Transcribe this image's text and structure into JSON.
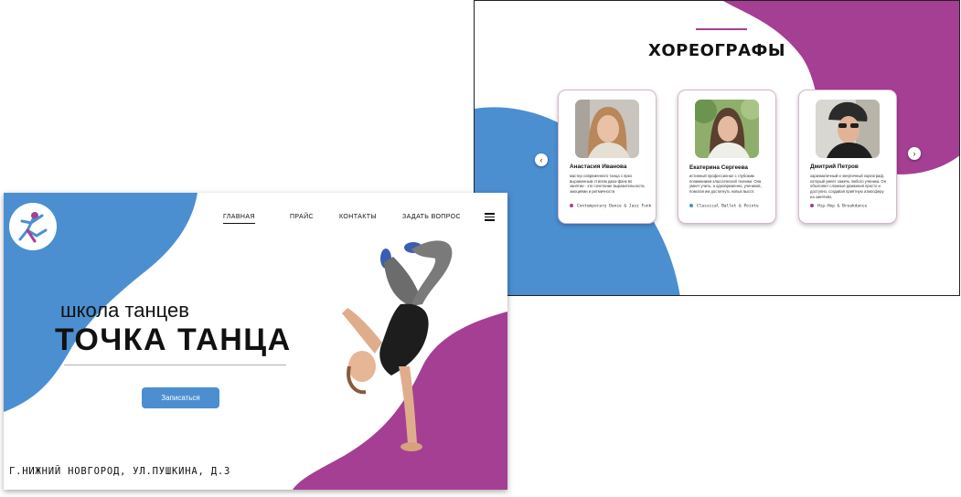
{
  "choreographers": {
    "title": "ХОРЕОГРАФЫ",
    "prev_arrow": "‹",
    "next_arrow": "›",
    "cards": [
      {
        "name": "Анастасия Иванова",
        "description": "мастер современного танца с ярко выраженным стилем джаз-фанк во занятии - это сочетание выразительности, эмоциями и ритмичности",
        "tag": "Contemporary Dance & Jazz Funk",
        "dot_color": "#a53f93"
      },
      {
        "name": "Екатерина Сергеева",
        "description": "истинный профессионал с глубоким пониманием классической техники. Она умеет учить, а одновременно, учеников, помогая им достигнуть новых высот.",
        "tag": "Classical Ballet & Pointe",
        "dot_color": "#4b8fd1"
      },
      {
        "name": "Дмитрий Петров",
        "description": "харизматичный и энергичный хореограф, который умеет зажечь любого ученика. Он объясняет сложные движения просто и доступно, создавая приятную атмосферу на занятиях.",
        "tag": "Hip-Hop & Breakdance",
        "dot_color": "#a53f93"
      }
    ]
  },
  "home": {
    "nav": {
      "home": "ГЛАВНАЯ",
      "price": "ПРАЙС",
      "contacts": "КОНТАКТЫ",
      "ask": "ЗАДАТЬ ВОПРОС"
    },
    "subtitle": "школа танцев",
    "title": "ТОЧКА ТАНЦА",
    "signup_button": "Записаться",
    "address": "Г.НИЖНИЙ НОВГОРОД, УЛ.ПУШКИНА, Д.3"
  },
  "colors": {
    "blue": "#4b8fd1",
    "purple": "#a53f93"
  }
}
